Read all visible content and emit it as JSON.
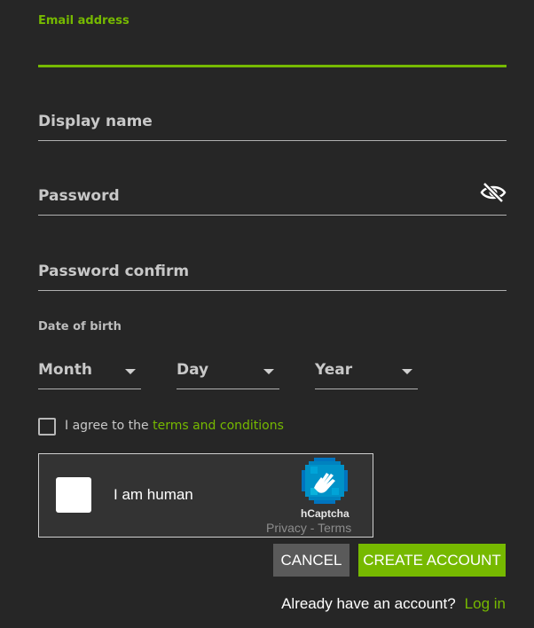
{
  "fields": {
    "email": {
      "label": "Email address",
      "value": ""
    },
    "display_name": {
      "label": "Display name"
    },
    "password": {
      "label": "Password"
    },
    "password_confirm": {
      "label": "Password confirm"
    }
  },
  "dob": {
    "label": "Date of birth",
    "month": "Month",
    "day": "Day",
    "year": "Year"
  },
  "agree": {
    "prefix": "I agree to the",
    "link": "terms and conditions"
  },
  "captcha": {
    "label": "I am human",
    "brand": "hCaptcha",
    "privacy": "Privacy",
    "separator": " - ",
    "terms": "Terms"
  },
  "buttons": {
    "cancel": "CANCEL",
    "create": "CREATE ACCOUNT"
  },
  "footer": {
    "question": "Already have an account?",
    "login": "Log in"
  },
  "colors": {
    "accent": "#76b900",
    "background": "#262626"
  },
  "icons": {
    "password_toggle": "eye-slash-icon",
    "captcha_logo": "hcaptcha-hand-icon"
  }
}
